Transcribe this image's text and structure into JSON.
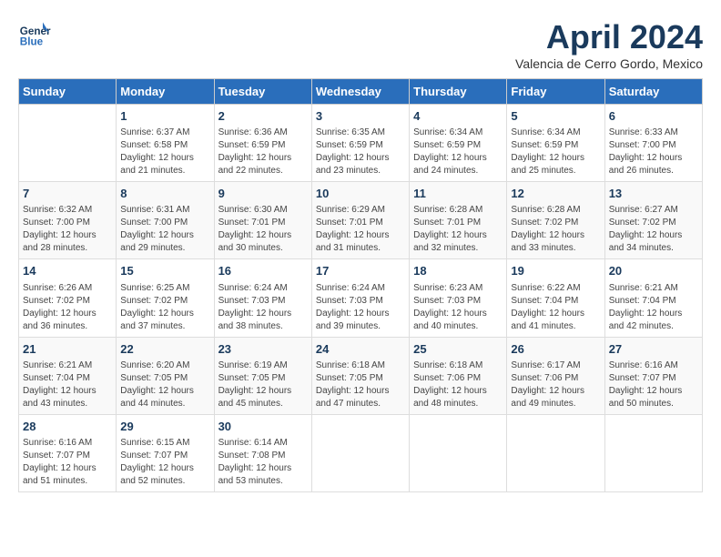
{
  "header": {
    "logo_line1": "General",
    "logo_line2": "Blue",
    "month_title": "April 2024",
    "subtitle": "Valencia de Cerro Gordo, Mexico"
  },
  "days_of_week": [
    "Sunday",
    "Monday",
    "Tuesday",
    "Wednesday",
    "Thursday",
    "Friday",
    "Saturday"
  ],
  "weeks": [
    [
      {
        "day": "",
        "info": ""
      },
      {
        "day": "1",
        "info": "Sunrise: 6:37 AM\nSunset: 6:58 PM\nDaylight: 12 hours\nand 21 minutes."
      },
      {
        "day": "2",
        "info": "Sunrise: 6:36 AM\nSunset: 6:59 PM\nDaylight: 12 hours\nand 22 minutes."
      },
      {
        "day": "3",
        "info": "Sunrise: 6:35 AM\nSunset: 6:59 PM\nDaylight: 12 hours\nand 23 minutes."
      },
      {
        "day": "4",
        "info": "Sunrise: 6:34 AM\nSunset: 6:59 PM\nDaylight: 12 hours\nand 24 minutes."
      },
      {
        "day": "5",
        "info": "Sunrise: 6:34 AM\nSunset: 6:59 PM\nDaylight: 12 hours\nand 25 minutes."
      },
      {
        "day": "6",
        "info": "Sunrise: 6:33 AM\nSunset: 7:00 PM\nDaylight: 12 hours\nand 26 minutes."
      }
    ],
    [
      {
        "day": "7",
        "info": "Sunrise: 6:32 AM\nSunset: 7:00 PM\nDaylight: 12 hours\nand 28 minutes."
      },
      {
        "day": "8",
        "info": "Sunrise: 6:31 AM\nSunset: 7:00 PM\nDaylight: 12 hours\nand 29 minutes."
      },
      {
        "day": "9",
        "info": "Sunrise: 6:30 AM\nSunset: 7:01 PM\nDaylight: 12 hours\nand 30 minutes."
      },
      {
        "day": "10",
        "info": "Sunrise: 6:29 AM\nSunset: 7:01 PM\nDaylight: 12 hours\nand 31 minutes."
      },
      {
        "day": "11",
        "info": "Sunrise: 6:28 AM\nSunset: 7:01 PM\nDaylight: 12 hours\nand 32 minutes."
      },
      {
        "day": "12",
        "info": "Sunrise: 6:28 AM\nSunset: 7:02 PM\nDaylight: 12 hours\nand 33 minutes."
      },
      {
        "day": "13",
        "info": "Sunrise: 6:27 AM\nSunset: 7:02 PM\nDaylight: 12 hours\nand 34 minutes."
      }
    ],
    [
      {
        "day": "14",
        "info": "Sunrise: 6:26 AM\nSunset: 7:02 PM\nDaylight: 12 hours\nand 36 minutes."
      },
      {
        "day": "15",
        "info": "Sunrise: 6:25 AM\nSunset: 7:02 PM\nDaylight: 12 hours\nand 37 minutes."
      },
      {
        "day": "16",
        "info": "Sunrise: 6:24 AM\nSunset: 7:03 PM\nDaylight: 12 hours\nand 38 minutes."
      },
      {
        "day": "17",
        "info": "Sunrise: 6:24 AM\nSunset: 7:03 PM\nDaylight: 12 hours\nand 39 minutes."
      },
      {
        "day": "18",
        "info": "Sunrise: 6:23 AM\nSunset: 7:03 PM\nDaylight: 12 hours\nand 40 minutes."
      },
      {
        "day": "19",
        "info": "Sunrise: 6:22 AM\nSunset: 7:04 PM\nDaylight: 12 hours\nand 41 minutes."
      },
      {
        "day": "20",
        "info": "Sunrise: 6:21 AM\nSunset: 7:04 PM\nDaylight: 12 hours\nand 42 minutes."
      }
    ],
    [
      {
        "day": "21",
        "info": "Sunrise: 6:21 AM\nSunset: 7:04 PM\nDaylight: 12 hours\nand 43 minutes."
      },
      {
        "day": "22",
        "info": "Sunrise: 6:20 AM\nSunset: 7:05 PM\nDaylight: 12 hours\nand 44 minutes."
      },
      {
        "day": "23",
        "info": "Sunrise: 6:19 AM\nSunset: 7:05 PM\nDaylight: 12 hours\nand 45 minutes."
      },
      {
        "day": "24",
        "info": "Sunrise: 6:18 AM\nSunset: 7:05 PM\nDaylight: 12 hours\nand 47 minutes."
      },
      {
        "day": "25",
        "info": "Sunrise: 6:18 AM\nSunset: 7:06 PM\nDaylight: 12 hours\nand 48 minutes."
      },
      {
        "day": "26",
        "info": "Sunrise: 6:17 AM\nSunset: 7:06 PM\nDaylight: 12 hours\nand 49 minutes."
      },
      {
        "day": "27",
        "info": "Sunrise: 6:16 AM\nSunset: 7:07 PM\nDaylight: 12 hours\nand 50 minutes."
      }
    ],
    [
      {
        "day": "28",
        "info": "Sunrise: 6:16 AM\nSunset: 7:07 PM\nDaylight: 12 hours\nand 51 minutes."
      },
      {
        "day": "29",
        "info": "Sunrise: 6:15 AM\nSunset: 7:07 PM\nDaylight: 12 hours\nand 52 minutes."
      },
      {
        "day": "30",
        "info": "Sunrise: 6:14 AM\nSunset: 7:08 PM\nDaylight: 12 hours\nand 53 minutes."
      },
      {
        "day": "",
        "info": ""
      },
      {
        "day": "",
        "info": ""
      },
      {
        "day": "",
        "info": ""
      },
      {
        "day": "",
        "info": ""
      }
    ]
  ]
}
